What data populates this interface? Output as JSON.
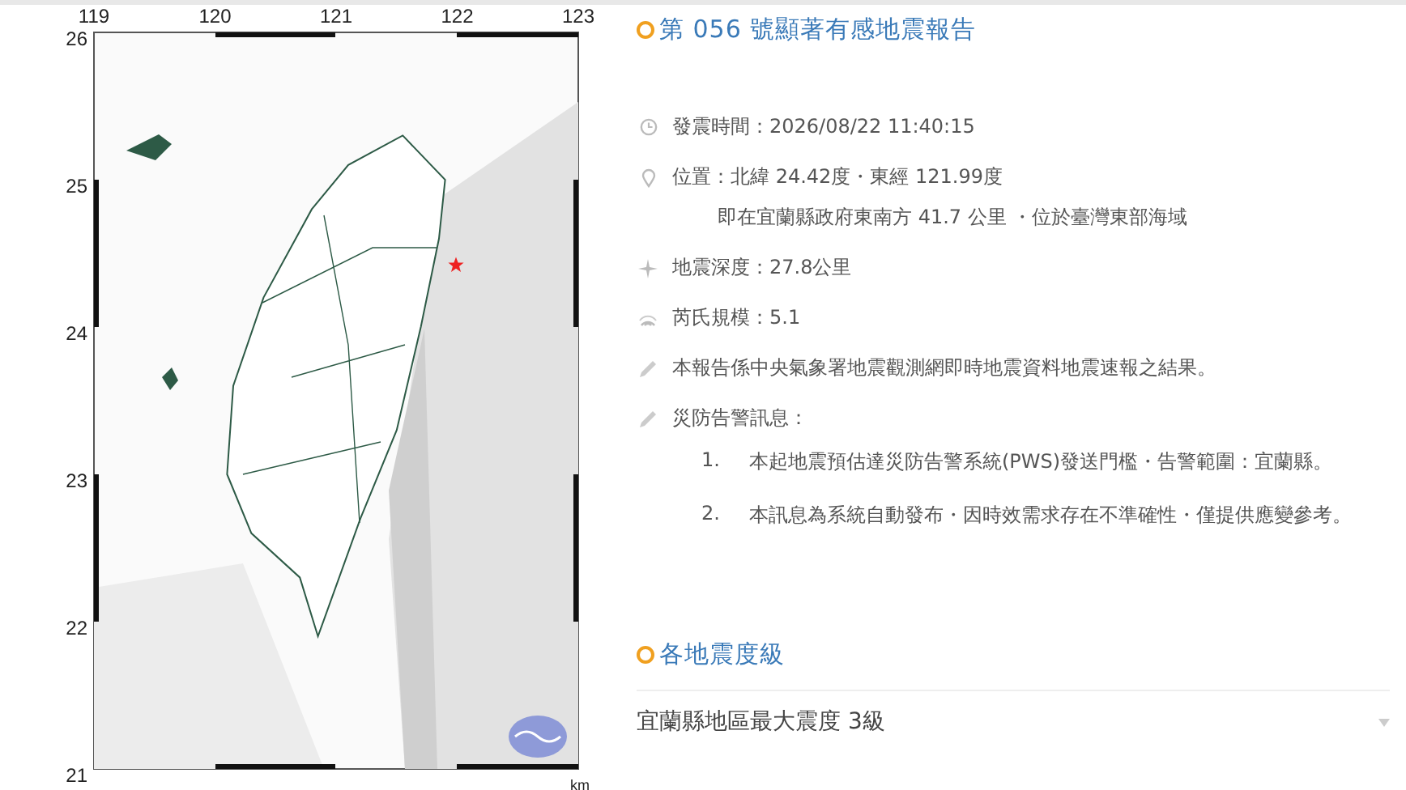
{
  "map": {
    "x_ticks": [
      "119",
      "120",
      "121",
      "122",
      "123"
    ],
    "y_ticks": [
      "26",
      "25",
      "24",
      "23",
      "22",
      "21"
    ],
    "unit": "km"
  },
  "report": {
    "title": "第 056 號顯著有感地震報告",
    "details": [
      {
        "kind": "time",
        "text": "發震時間：2026/08/22 11:40:15"
      },
      {
        "kind": "location",
        "text": "位置：北緯 24.42度・東經 121.99度",
        "note": "即在宜蘭縣政府東南方 41.7 公里 ・位於臺灣東部海域"
      },
      {
        "kind": "depth",
        "text": "地震深度：27.8公里"
      },
      {
        "kind": "magnitude",
        "text": "芮氏規模：5.1"
      },
      {
        "kind": "note",
        "text": "本報告係中央氣象署地震觀測網即時地震資料地震速報之結果。"
      },
      {
        "kind": "note",
        "text": "災防告警訊息："
      }
    ],
    "alerts": [
      {
        "number": "1.",
        "text": "本起地震預估達災防告警系統(PWS)發送門檻・告警範圍：宜蘭縣。"
      },
      {
        "number": "2.",
        "text": "本訊息為系統自動發布・因時效需求存在不準確性・僅提供應變參考。"
      }
    ]
  },
  "intensity": {
    "title": "各地震度級",
    "regions": [
      {
        "label": "宜蘭縣地區最大震度 3級",
        "expanded": false
      }
    ]
  }
}
